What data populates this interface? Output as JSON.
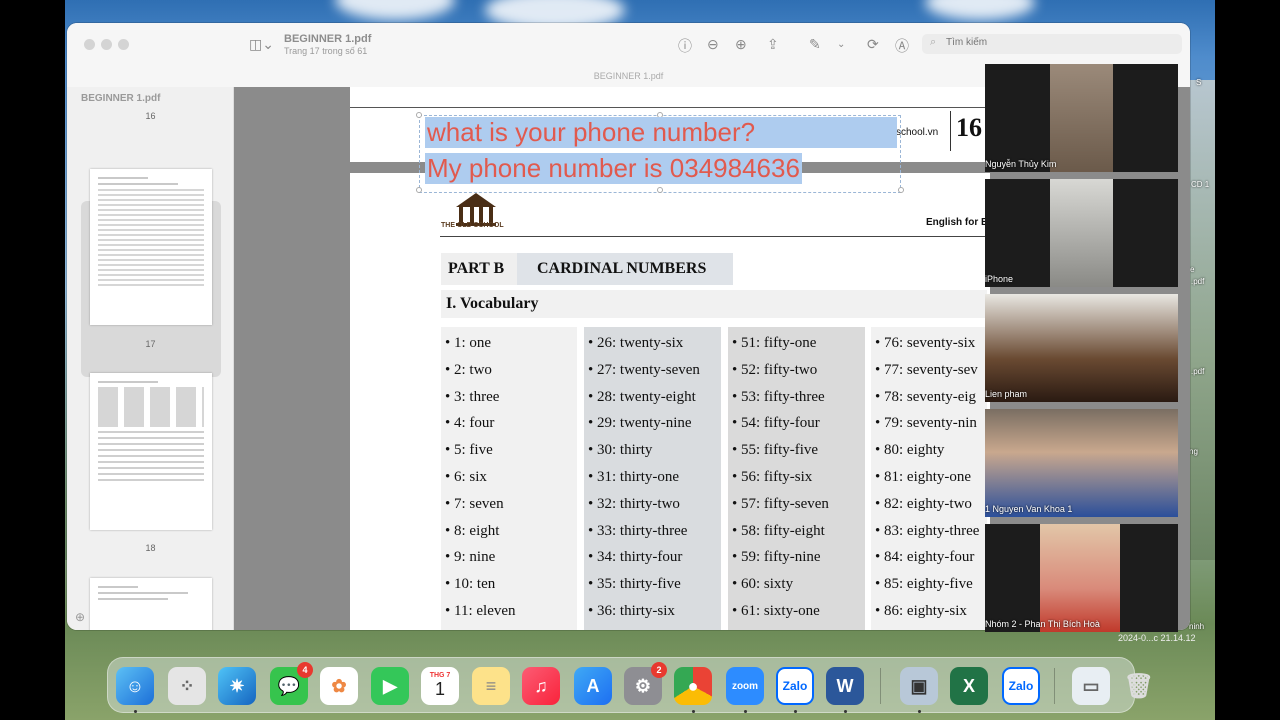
{
  "window": {
    "doc_title": "BEGINNER 1.pdf",
    "doc_subtitle": "Trang 17 trong số 61",
    "tab_title": "BEGINNER 1.pdf",
    "search_placeholder": "Tìm kiếm"
  },
  "sidebar": {
    "title": "BEGINNER 1.pdf",
    "pages": [
      "16",
      "17",
      "18"
    ]
  },
  "annotation": {
    "line1": "what is your phone number?",
    "line2": "My phone number is 034984636"
  },
  "page_header": {
    "site": "school.vn",
    "page_number": "16",
    "logo_text": "THE OLD SCHOOL",
    "english_for": "English for Eld"
  },
  "section": {
    "part_tag": "PART B",
    "part_title": "CARDINAL NUMBERS",
    "vocab_title": "I. Vocabulary"
  },
  "vocabulary_columns": [
    [
      "• 1: one",
      "• 2: two",
      "• 3: three",
      "• 4: four",
      "• 5: five",
      "• 6: six",
      "• 7: seven",
      "• 8: eight",
      "• 9: nine",
      "• 10: ten",
      "• 11: eleven"
    ],
    [
      "• 26: twenty-six",
      "• 27: twenty-seven",
      "• 28: twenty-eight",
      "• 29: twenty-nine",
      "• 30: thirty",
      "• 31: thirty-one",
      "• 32: thirty-two",
      "• 33: thirty-three",
      "• 34: thirty-four",
      "• 35: thirty-five",
      "• 36: thirty-six"
    ],
    [
      "• 51: fifty-one",
      "• 52: fifty-two",
      "• 53: fifty-three",
      "• 54: fifty-four",
      "• 55: fifty-five",
      "• 56: fifty-six",
      "• 57: fifty-seven",
      "• 58: fifty-eight",
      "• 59: fifty-nine",
      "• 60: sixty",
      "• 61: sixty-one"
    ],
    [
      "• 76: seventy-six",
      "• 77: seventy-sev",
      "• 78: seventy-eig",
      "• 79: seventy-nin",
      "• 80: eighty",
      "• 81: eighty-one",
      "• 82: eighty-two",
      "• 83: eighty-three",
      "• 84: eighty-four",
      "• 85: eighty-five",
      "• 86: eighty-six"
    ]
  ],
  "participants": [
    {
      "name": "Nguyễn Thủy Kim"
    },
    {
      "name": "iPhone"
    },
    {
      "name": "Lien pham"
    },
    {
      "name": "1 Nguyen Van Khoa 1"
    },
    {
      "name": "Nhóm 2 - Phan Thị Bích Hoà"
    }
  ],
  "background_labels": {
    "s": "S",
    "cd1": "CD 1",
    "pdf1": ".pdf",
    "pdf2": ".pdf",
    "e": "e",
    "ng": "ng",
    "ninh": "ninh",
    "clock": "2024-0...c 21.14.12"
  },
  "dock": {
    "messages_badge": "4",
    "settings_badge": "2",
    "calendar_month": "THG 7",
    "calendar_day": "1",
    "zoom_label": "zoom",
    "zalo_label": "Zalo",
    "word_label": "W",
    "excel_label": "X"
  },
  "colors": {
    "annotation_text": "#e15a4e",
    "annotation_highlight": "#aeccef",
    "part_bg": "#dfe3e8"
  }
}
